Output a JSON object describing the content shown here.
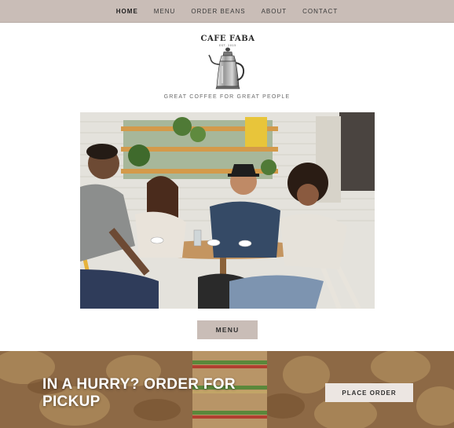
{
  "nav": {
    "items": [
      {
        "label": "HOME",
        "active": true
      },
      {
        "label": "MENU",
        "active": false
      },
      {
        "label": "ORDER BEANS",
        "active": false
      },
      {
        "label": "ABOUT",
        "active": false
      },
      {
        "label": "CONTACT",
        "active": false
      }
    ]
  },
  "logo": {
    "name": "CAFE FABA",
    "sub": "EST. 2015"
  },
  "tagline": "GREAT COFFEE FOR GREAT PEOPLE",
  "hero": {
    "icon": "cafe-photo"
  },
  "menu_button": "MENU",
  "banner": {
    "title": "IN A HURRY? ORDER FOR PICKUP",
    "button": "PLACE ORDER"
  },
  "colors": {
    "nav_bg": "#c9bdb7",
    "button_bg": "#c9bdb7",
    "order_button_bg": "#ece6e2"
  }
}
